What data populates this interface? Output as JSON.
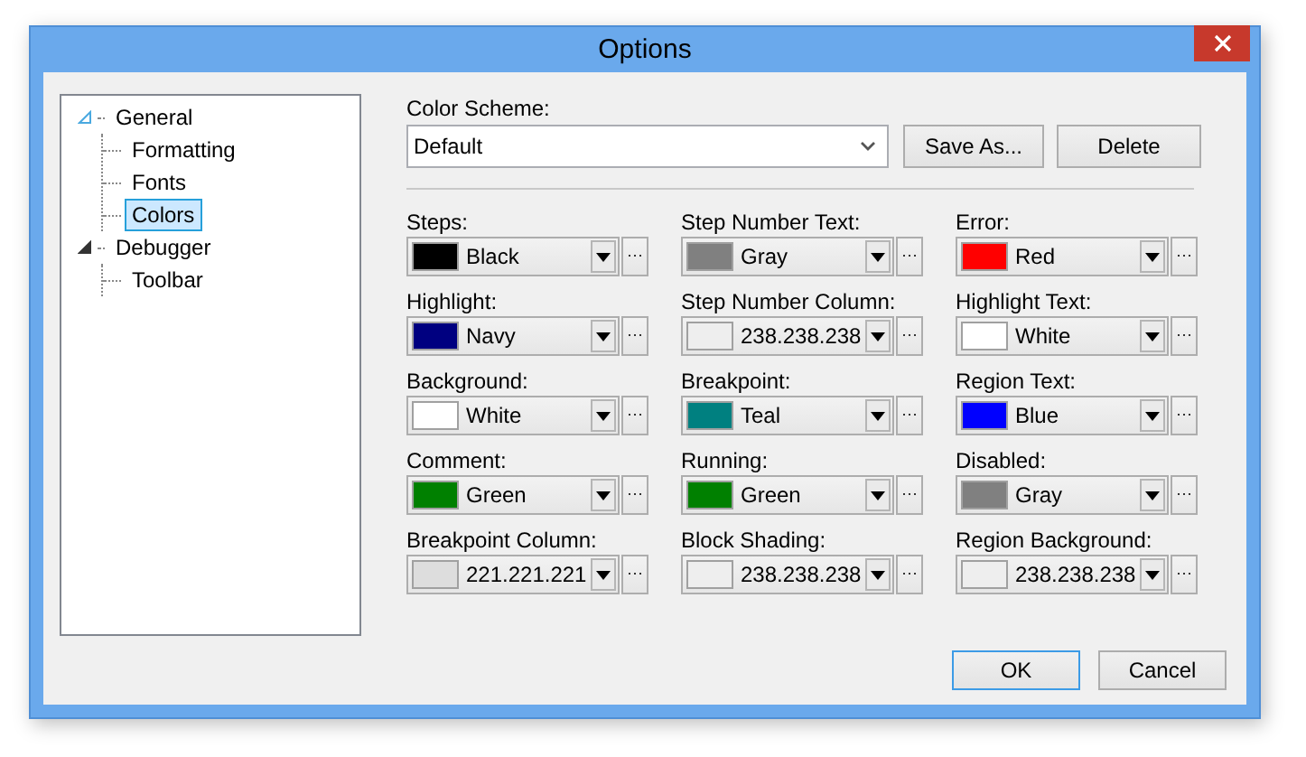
{
  "window": {
    "title": "Options"
  },
  "tree": [
    {
      "label": "General",
      "expanded": true,
      "selected": false,
      "children": [
        {
          "label": "Formatting",
          "selected": false
        },
        {
          "label": "Fonts",
          "selected": false
        },
        {
          "label": "Colors",
          "selected": true
        }
      ]
    },
    {
      "label": "Debugger",
      "expanded": true,
      "selected": false,
      "children": [
        {
          "label": "Toolbar",
          "selected": false
        }
      ]
    }
  ],
  "color_scheme": {
    "label": "Color Scheme:",
    "value": "Default"
  },
  "scheme_buttons": [
    "Save As...",
    "Delete"
  ],
  "colors": [
    {
      "label": "Steps:",
      "value": "Black",
      "color": "#000000"
    },
    {
      "label": "Step Number Text:",
      "value": "Gray",
      "color": "#808080"
    },
    {
      "label": "Error:",
      "value": "Red",
      "color": "#ff0000"
    },
    {
      "label": "Highlight:",
      "value": "Navy",
      "color": "#000080"
    },
    {
      "label": "Step Number Column:",
      "value": "238.238.238",
      "color": "#eeeeee"
    },
    {
      "label": "Highlight Text:",
      "value": "White",
      "color": "#ffffff"
    },
    {
      "label": "Background:",
      "value": "White",
      "color": "#ffffff"
    },
    {
      "label": "Breakpoint:",
      "value": "Teal",
      "color": "#008080"
    },
    {
      "label": "Region Text:",
      "value": "Blue",
      "color": "#0000ff"
    },
    {
      "label": "Comment:",
      "value": "Green",
      "color": "#008000"
    },
    {
      "label": "Running:",
      "value": "Green",
      "color": "#008000"
    },
    {
      "label": "Disabled:",
      "value": "Gray",
      "color": "#808080"
    },
    {
      "label": "Breakpoint Column:",
      "value": "221.221.221",
      "color": "#dddddd"
    },
    {
      "label": "Block Shading:",
      "value": "238.238.238",
      "color": "#eeeeee"
    },
    {
      "label": "Region Background:",
      "value": "238.238.238",
      "color": "#eeeeee"
    }
  ],
  "dialog_buttons": [
    {
      "label": "OK",
      "default": true
    },
    {
      "label": "Cancel",
      "default": false
    }
  ]
}
